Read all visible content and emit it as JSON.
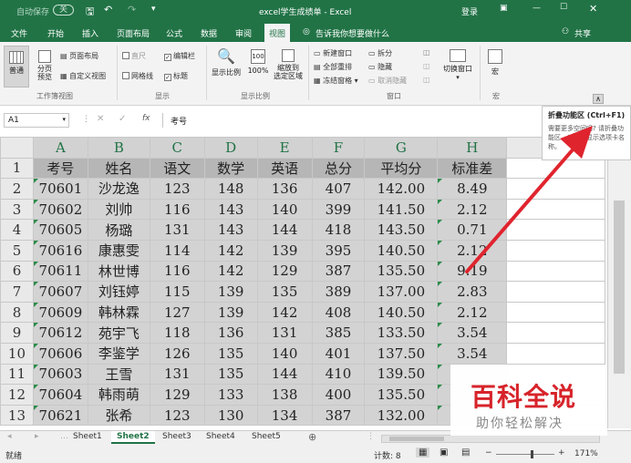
{
  "titlebar": {
    "autosave": "自动保存",
    "autosave_state": "关",
    "file_title": "excel学生成绩单 - Excel",
    "login": "登录"
  },
  "menu": [
    "文件",
    "开始",
    "插入",
    "页面布局",
    "公式",
    "数据",
    "审阅",
    "视图"
  ],
  "tell_me": "告诉我你想要做什么",
  "share": "共享",
  "ribbon": {
    "normal": "普通",
    "page_break": "分页\n预览",
    "page_layout": "页面布局",
    "custom_view": "自定义视图",
    "group_views": "工作簿视图",
    "ruler": "直尺",
    "formula_bar": "编辑栏",
    "gridlines": "网格线",
    "headings": "标题",
    "group_show": "显示",
    "zoom": "显示比例",
    "zoom100": "100%",
    "zoom_selection": "缩放到\n选定区域",
    "group_zoom": "显示比例",
    "new_window": "新建窗口",
    "arrange_all": "全部重排",
    "freeze": "冻结窗格",
    "split": "拆分",
    "hide": "隐藏",
    "unhide": "取消隐藏",
    "switch_window": "切换窗口",
    "group_window": "窗口",
    "macros": "宏",
    "group_macros": "宏"
  },
  "tooltip": {
    "title": "折叠功能区 (Ctrl+F1)",
    "body": "需要更多空间吗? 请折叠功能区，以便仅显示选项卡名称。"
  },
  "formula": {
    "name_box": "A1",
    "fx": "fx",
    "content": "考号"
  },
  "columns": [
    "A",
    "B",
    "C",
    "D",
    "E",
    "F",
    "G",
    "H"
  ],
  "rows": [
    [
      "1",
      "考号",
      "姓名",
      "语文",
      "数学",
      "英语",
      "总分",
      "平均分",
      "标准差"
    ],
    [
      "2",
      "70601",
      "沙龙逸",
      "123",
      "148",
      "136",
      "407",
      "142.00",
      "8.49"
    ],
    [
      "3",
      "70602",
      "刘帅",
      "116",
      "143",
      "140",
      "399",
      "141.50",
      "2.12"
    ],
    [
      "4",
      "70605",
      "杨璐",
      "131",
      "143",
      "144",
      "418",
      "143.50",
      "0.71"
    ],
    [
      "5",
      "70616",
      "康惠雯",
      "114",
      "142",
      "139",
      "395",
      "140.50",
      "2.12"
    ],
    [
      "6",
      "70611",
      "林世博",
      "116",
      "142",
      "129",
      "387",
      "135.50",
      "9.19"
    ],
    [
      "7",
      "70607",
      "刘钰婷",
      "115",
      "139",
      "135",
      "389",
      "137.00",
      "2.83"
    ],
    [
      "8",
      "70609",
      "韩林霖",
      "127",
      "139",
      "142",
      "408",
      "140.50",
      "2.12"
    ],
    [
      "9",
      "70612",
      "苑宇飞",
      "118",
      "136",
      "131",
      "385",
      "133.50",
      "3.54"
    ],
    [
      "10",
      "70606",
      "李鉴学",
      "126",
      "135",
      "140",
      "401",
      "137.50",
      "3.54"
    ],
    [
      "11",
      "70603",
      "王雪",
      "131",
      "135",
      "144",
      "410",
      "139.50",
      ""
    ],
    [
      "12",
      "70604",
      "韩雨萌",
      "129",
      "133",
      "138",
      "400",
      "135.50",
      ""
    ],
    [
      "13",
      "70621",
      "张希",
      "123",
      "130",
      "134",
      "387",
      "132.00",
      ""
    ]
  ],
  "sheets": [
    "Sheet1",
    "Sheet2",
    "Sheet3",
    "Sheet4",
    "Sheet5"
  ],
  "active_sheet": "Sheet2",
  "status": {
    "ready": "就绪",
    "count": "计数: 8",
    "zoom": "171%"
  },
  "watermark": {
    "title": "百科全说",
    "subtitle": "助你轻松解决"
  },
  "colors": {
    "excel_green": "#217346",
    "arrow_red": "#e0242e",
    "watermark_red": "#d7232a"
  }
}
